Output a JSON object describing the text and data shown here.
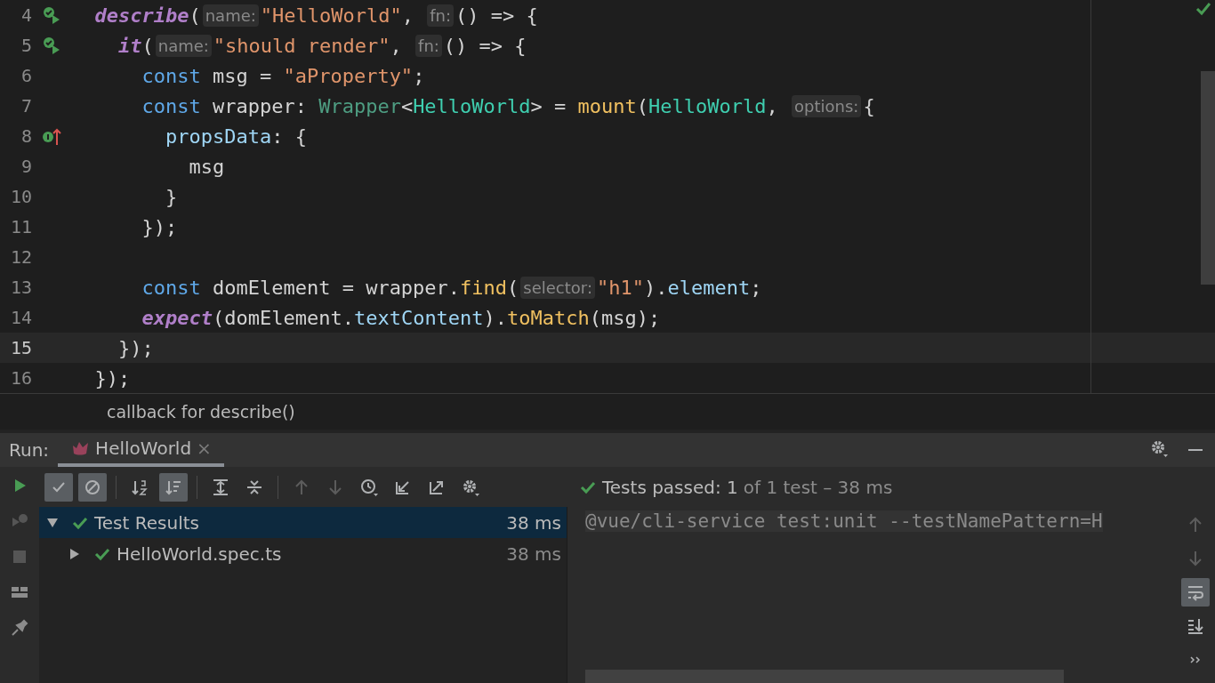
{
  "editor": {
    "lines": [
      {
        "number": "4",
        "gutter_icon": {
          "kind": "run"
        },
        "current": false,
        "tokens": [
          {
            "kind": "callee",
            "text": "  describe"
          },
          {
            "kind": "plain",
            "text": "("
          },
          {
            "kind": "hint",
            "text": "name:"
          },
          {
            "kind": "str",
            "text": "\"HelloWorld\""
          },
          {
            "kind": "plain",
            "text": ", "
          },
          {
            "kind": "hint",
            "text": "fn:"
          },
          {
            "kind": "plain",
            "text": "() => {"
          }
        ]
      },
      {
        "number": "5",
        "gutter_icon": {
          "kind": "run"
        },
        "current": false,
        "tokens": [
          {
            "kind": "callee",
            "text": "    it"
          },
          {
            "kind": "plain",
            "text": "("
          },
          {
            "kind": "hint",
            "text": "name:"
          },
          {
            "kind": "str",
            "text": "\"should render\""
          },
          {
            "kind": "plain",
            "text": ", "
          },
          {
            "kind": "hint",
            "text": "fn:"
          },
          {
            "kind": "plain",
            "text": "() => {"
          }
        ]
      },
      {
        "number": "6",
        "current": false,
        "tokens": [
          {
            "kind": "kw",
            "text": "      const"
          },
          {
            "kind": "plain",
            "text": " msg = "
          },
          {
            "kind": "str",
            "text": "\"aProperty\""
          },
          {
            "kind": "plain",
            "text": ";"
          }
        ]
      },
      {
        "number": "7",
        "current": false,
        "tokens": [
          {
            "kind": "kw",
            "text": "      const"
          },
          {
            "kind": "plain",
            "text": " wrapper: "
          },
          {
            "kind": "type",
            "text": "Wrapper"
          },
          {
            "kind": "plain",
            "text": "<"
          },
          {
            "kind": "cls",
            "text": "HelloWorld"
          },
          {
            "kind": "plain",
            "text": "> = "
          },
          {
            "kind": "fn",
            "text": "mount"
          },
          {
            "kind": "plain",
            "text": "("
          },
          {
            "kind": "cls",
            "text": "HelloWorld"
          },
          {
            "kind": "plain",
            "text": ", "
          },
          {
            "kind": "hint",
            "text": "options:"
          },
          {
            "kind": "plain",
            "text": "{"
          }
        ]
      },
      {
        "number": "8",
        "gutter_icon": {
          "kind": "implements"
        },
        "current": false,
        "tokens": [
          {
            "kind": "prop",
            "text": "        propsData"
          },
          {
            "kind": "plain",
            "text": ": {"
          }
        ]
      },
      {
        "number": "9",
        "current": false,
        "tokens": [
          {
            "kind": "plain",
            "text": "          msg"
          }
        ]
      },
      {
        "number": "10",
        "current": false,
        "tokens": [
          {
            "kind": "plain",
            "text": "        }"
          }
        ]
      },
      {
        "number": "11",
        "current": false,
        "tokens": [
          {
            "kind": "plain",
            "text": "      });"
          }
        ]
      },
      {
        "number": "12",
        "current": false
      },
      {
        "number": "13",
        "current": false,
        "tokens": [
          {
            "kind": "kw",
            "text": "      const"
          },
          {
            "kind": "plain",
            "text": " domElement = wrapper."
          },
          {
            "kind": "fn",
            "text": "find"
          },
          {
            "kind": "plain",
            "text": "("
          },
          {
            "kind": "hint",
            "text": "selector:"
          },
          {
            "kind": "str",
            "text": "\"h1\""
          },
          {
            "kind": "plain",
            "text": ")."
          },
          {
            "kind": "prop",
            "text": "element"
          },
          {
            "kind": "plain",
            "text": ";"
          }
        ]
      },
      {
        "number": "14",
        "current": false,
        "tokens": [
          {
            "kind": "callee",
            "text": "      expect"
          },
          {
            "kind": "plain",
            "text": "(domElement."
          },
          {
            "kind": "prop",
            "text": "textContent"
          },
          {
            "kind": "plain",
            "text": ")."
          },
          {
            "kind": "fn",
            "text": "toMatch"
          },
          {
            "kind": "plain",
            "text": "(msg);"
          }
        ]
      },
      {
        "number": "15",
        "current": true,
        "tokens": [
          {
            "kind": "plain",
            "text": "    });"
          }
        ]
      },
      {
        "number": "16",
        "current": false,
        "tokens": [
          {
            "kind": "plain",
            "text": "  });"
          }
        ]
      }
    ]
  },
  "breadcrumb": "callback for describe()",
  "run_panel": {
    "label": "Run:",
    "tabs": [
      {
        "title": "HelloWorld",
        "close": "×",
        "selected": true
      }
    ],
    "side_tools": [
      {
        "kind": "rerun",
        "disabled": false
      },
      {
        "kind": "rerun-failed",
        "disabled": true
      },
      {
        "kind": "stop",
        "disabled": true
      },
      {
        "kind": "layout",
        "disabled": false
      },
      {
        "kind": "pin",
        "disabled": false
      }
    ],
    "toolbar": [
      {
        "kind": "show-passed",
        "selected": true,
        "disabled": false
      },
      {
        "kind": "show-ignored",
        "selected": true,
        "disabled": false
      },
      {
        "kind": "sort-alpha",
        "selected": false,
        "disabled": false
      },
      {
        "kind": "sort-duration",
        "selected": true,
        "disabled": false
      },
      {
        "kind": "expand-all",
        "selected": false,
        "disabled": false
      },
      {
        "kind": "collapse-all",
        "selected": false,
        "disabled": false
      },
      {
        "kind": "previous",
        "selected": false,
        "disabled": true
      },
      {
        "kind": "next",
        "selected": false,
        "disabled": true
      },
      {
        "kind": "history",
        "selected": false,
        "disabled": false
      },
      {
        "kind": "import",
        "selected": false,
        "disabled": false
      },
      {
        "kind": "export",
        "selected": false,
        "disabled": false
      },
      {
        "kind": "settings",
        "selected": false,
        "disabled": false
      }
    ],
    "status": {
      "passed": "Tests passed: 1",
      "detail": "of 1 test – 38  ms"
    },
    "tree": [
      {
        "label": "Test Results",
        "duration": "38 ms",
        "expanded": true,
        "selected": true,
        "children": [
          {
            "label": "HelloWorld.spec.ts",
            "duration": "38 ms",
            "expanded": false,
            "selected": false
          }
        ]
      }
    ],
    "console": {
      "lines": [
        "@vue/cli-service test:unit --testNamePattern=H"
      ]
    },
    "console_tools": [
      {
        "kind": "up",
        "selected": false,
        "disabled": true
      },
      {
        "kind": "down",
        "selected": false,
        "disabled": true
      },
      {
        "kind": "soft-wrap",
        "selected": true,
        "disabled": false
      },
      {
        "kind": "scroll-end",
        "selected": false,
        "disabled": false
      },
      {
        "kind": "more",
        "selected": false,
        "disabled": false
      }
    ]
  }
}
